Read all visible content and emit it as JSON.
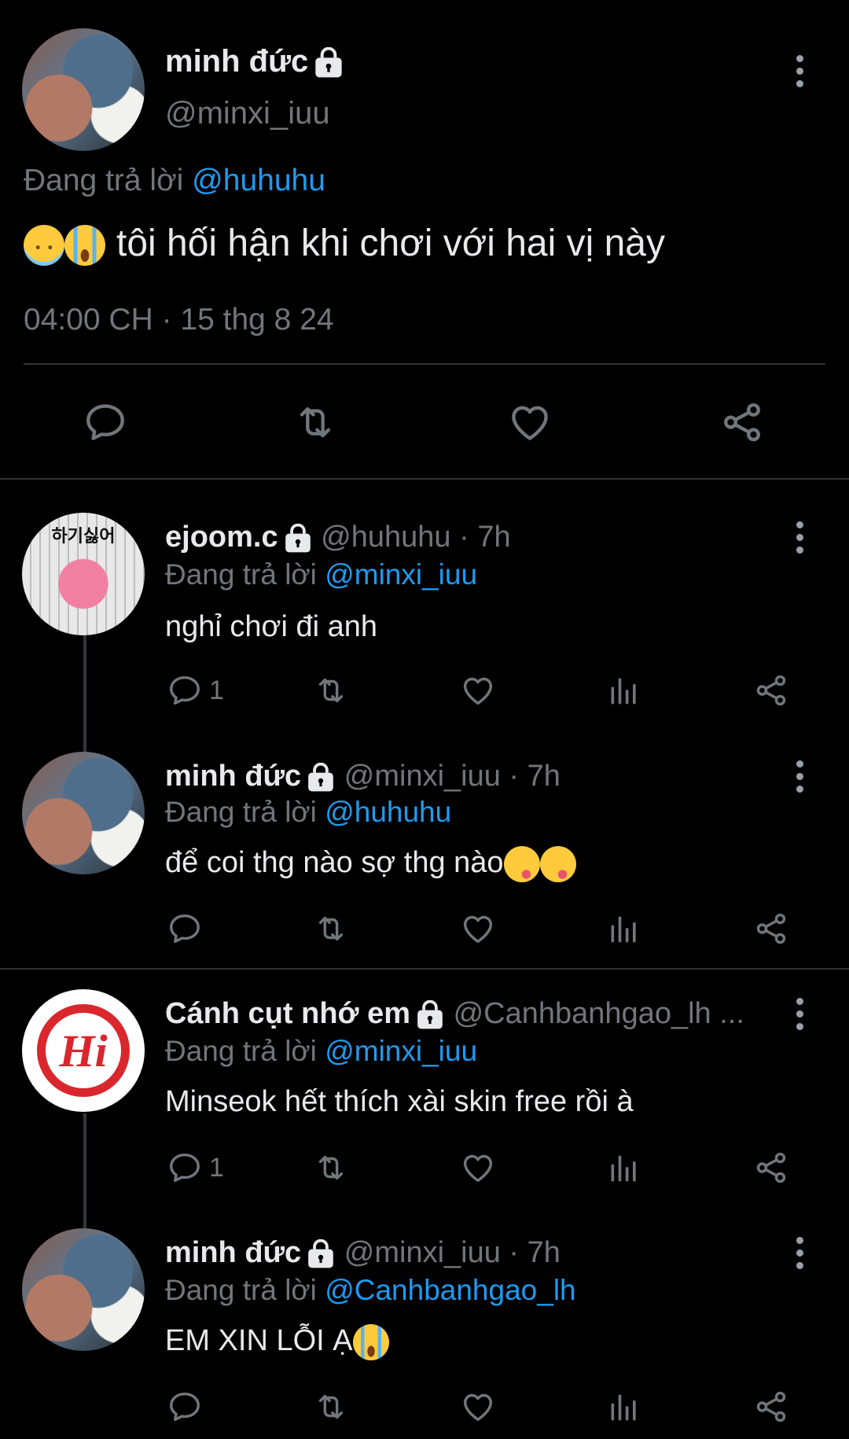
{
  "main_tweet": {
    "name": "minh đức",
    "handle": "@minxi_iuu",
    "reply_prefix": "Đang trả lời",
    "reply_to": "@huhuhu",
    "text": "tôi hối hận khi chơi với hai vị này",
    "timestamp": "04:00 CH · 15 thg 8 24"
  },
  "replies": [
    {
      "name": "ejoom.c",
      "handle": "@huhuhu",
      "time": "· 7h",
      "reply_prefix": "Đang trả lời",
      "reply_to": "@minxi_iuu",
      "text": "nghỉ chơi đi anh",
      "reply_count": "1",
      "avatar_text": "하기싫어"
    },
    {
      "name": "minh đức",
      "handle": "@minxi_iuu",
      "time": "· 7h",
      "reply_prefix": "Đang trả lời",
      "reply_to": "@huhuhu",
      "text": "để coi thg nào sợ thg nào",
      "reply_count": ""
    },
    {
      "name": "Cánh cụt nhớ em",
      "handle": "@Canhbanhgao_lh ...",
      "time": "",
      "reply_prefix": "Đang trả lời",
      "reply_to": "@minxi_iuu",
      "text": "Minseok hết thích xài skin free rồi à",
      "reply_count": "1",
      "avatar_text": "Hi"
    },
    {
      "name": "minh đức",
      "handle": "@minxi_iuu",
      "time": "· 7h",
      "reply_prefix": "Đang trả lời",
      "reply_to": "@Canhbanhgao_lh",
      "text": "EM XIN LỖI Ạ",
      "reply_count": ""
    }
  ],
  "colors": {
    "background": "#000000",
    "text": "#e7e9ea",
    "muted": "#71767b",
    "link": "#1d9bf0",
    "divider": "#2f3336"
  },
  "icons": [
    "lock-icon",
    "more-icon",
    "reply-icon",
    "retweet-icon",
    "like-icon",
    "share-icon",
    "views-icon"
  ]
}
